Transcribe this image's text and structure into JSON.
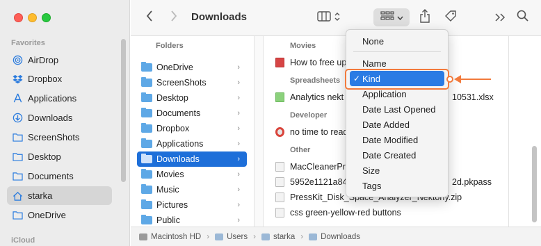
{
  "window": {
    "title": "Downloads"
  },
  "sidebar": {
    "favorites_label": "Favorites",
    "icloud_label": "iCloud",
    "items": [
      {
        "label": "AirDrop",
        "icon": "airdrop-icon"
      },
      {
        "label": "Dropbox",
        "icon": "dropbox-icon"
      },
      {
        "label": "Applications",
        "icon": "applications-icon"
      },
      {
        "label": "Downloads",
        "icon": "downloads-icon"
      },
      {
        "label": "ScreenShots",
        "icon": "folder-icon"
      },
      {
        "label": "Desktop",
        "icon": "folder-icon"
      },
      {
        "label": "Documents",
        "icon": "folder-icon"
      },
      {
        "label": "starka",
        "icon": "home-icon",
        "selected": true
      },
      {
        "label": "OneDrive",
        "icon": "folder-icon"
      }
    ]
  },
  "columns": {
    "col1_header": "Folders",
    "col1_items": [
      {
        "label": "OneDrive"
      },
      {
        "label": "ScreenShots"
      },
      {
        "label": "Desktop"
      },
      {
        "label": "Documents"
      },
      {
        "label": "Dropbox"
      },
      {
        "label": "Applications"
      },
      {
        "label": "Downloads",
        "selected": true
      },
      {
        "label": "Movies"
      },
      {
        "label": "Music"
      },
      {
        "label": "Pictures"
      },
      {
        "label": "Public"
      }
    ],
    "groups": {
      "movies": "Movies",
      "spreadsheets": "Spreadsheets",
      "developer": "Developer",
      "other": "Other"
    },
    "files": {
      "movie1": "How to free up",
      "sheet1_a": "Analytics nekt",
      "sheet1_b": "10531.xlsx",
      "dev1": "no time to read",
      "other1": "MacCleanerPr",
      "other2_a": "5952e1121a84",
      "other2_b": "2d.pkpass",
      "other3": "PressKit_Disk_Space_Analyzer_Nektony.zip",
      "other4": "css green-yellow-red buttons"
    }
  },
  "pathbar": {
    "items": [
      "Macintosh HD",
      "Users",
      "starka",
      "Downloads"
    ],
    "separator": "›"
  },
  "group_menu": {
    "items": [
      {
        "label": "None"
      },
      {
        "label": "Name"
      },
      {
        "label": "Kind",
        "checked": true
      },
      {
        "label": "Application"
      },
      {
        "label": "Date Last Opened"
      },
      {
        "label": "Date Added"
      },
      {
        "label": "Date Modified"
      },
      {
        "label": "Date Created"
      },
      {
        "label": "Size"
      },
      {
        "label": "Tags"
      }
    ],
    "check_glyph": "✓"
  },
  "colors": {
    "accent": "#2a7be4",
    "annotation": "#f27a3c",
    "selection": "#1e6fd9"
  }
}
